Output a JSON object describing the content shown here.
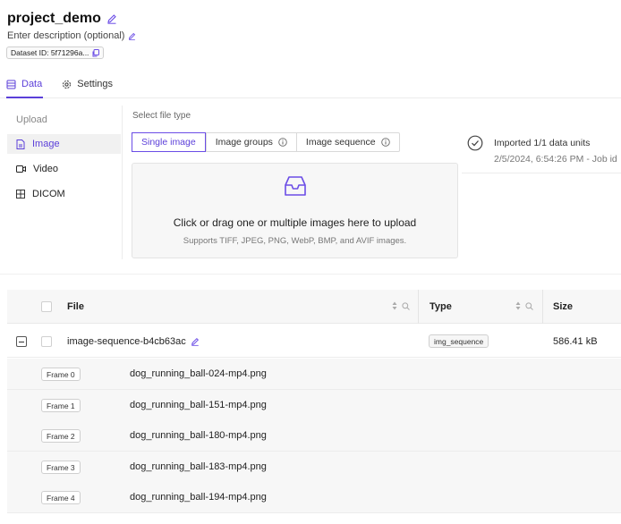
{
  "project": {
    "title": "project_demo",
    "description_placeholder": "Enter description (optional)",
    "dataset_id": "Dataset ID: 5f71296a..."
  },
  "tabs": [
    {
      "label": "Data",
      "icon": "database-icon",
      "active": true
    },
    {
      "label": "Settings",
      "icon": "gear-icon",
      "active": false
    }
  ],
  "sidebar": {
    "heading": "Upload",
    "items": [
      {
        "label": "Image",
        "icon": "image-file-icon",
        "selected": true
      },
      {
        "label": "Video",
        "icon": "video-icon",
        "selected": false
      },
      {
        "label": "DICOM",
        "icon": "grid-icon",
        "selected": false
      }
    ]
  },
  "file_type": {
    "label": "Select file type",
    "options": [
      {
        "label": "Single image",
        "active": true
      },
      {
        "label": "Image groups",
        "active": false
      },
      {
        "label": "Image sequence",
        "active": false
      }
    ]
  },
  "dropzone": {
    "text": "Click or drag one or multiple images here to upload",
    "subtext": "Supports TIFF, JPEG, PNG, WebP, BMP, and AVIF images."
  },
  "status": {
    "title": "Imported 1/1 data units",
    "subtitle": "2/5/2024, 6:54:26 PM - Job id"
  },
  "table": {
    "columns": [
      "File",
      "Type",
      "Size"
    ],
    "group_row": {
      "file": "image-sequence-b4cb63ac",
      "type": "img_sequence",
      "size": "586.41 kB"
    },
    "frames": [
      {
        "tag": "Frame 0",
        "file": "dog_running_ball-024-mp4.png"
      },
      {
        "tag": "Frame 1",
        "file": "dog_running_ball-151-mp4.png"
      },
      {
        "tag": "Frame 2",
        "file": "dog_running_ball-180-mp4.png"
      },
      {
        "tag": "Frame 3",
        "file": "dog_running_ball-183-mp4.png"
      },
      {
        "tag": "Frame 4",
        "file": "dog_running_ball-194-mp4.png"
      }
    ]
  },
  "colors": {
    "accent": "#5b3fd9",
    "row_bg": "#f7f7f7"
  }
}
